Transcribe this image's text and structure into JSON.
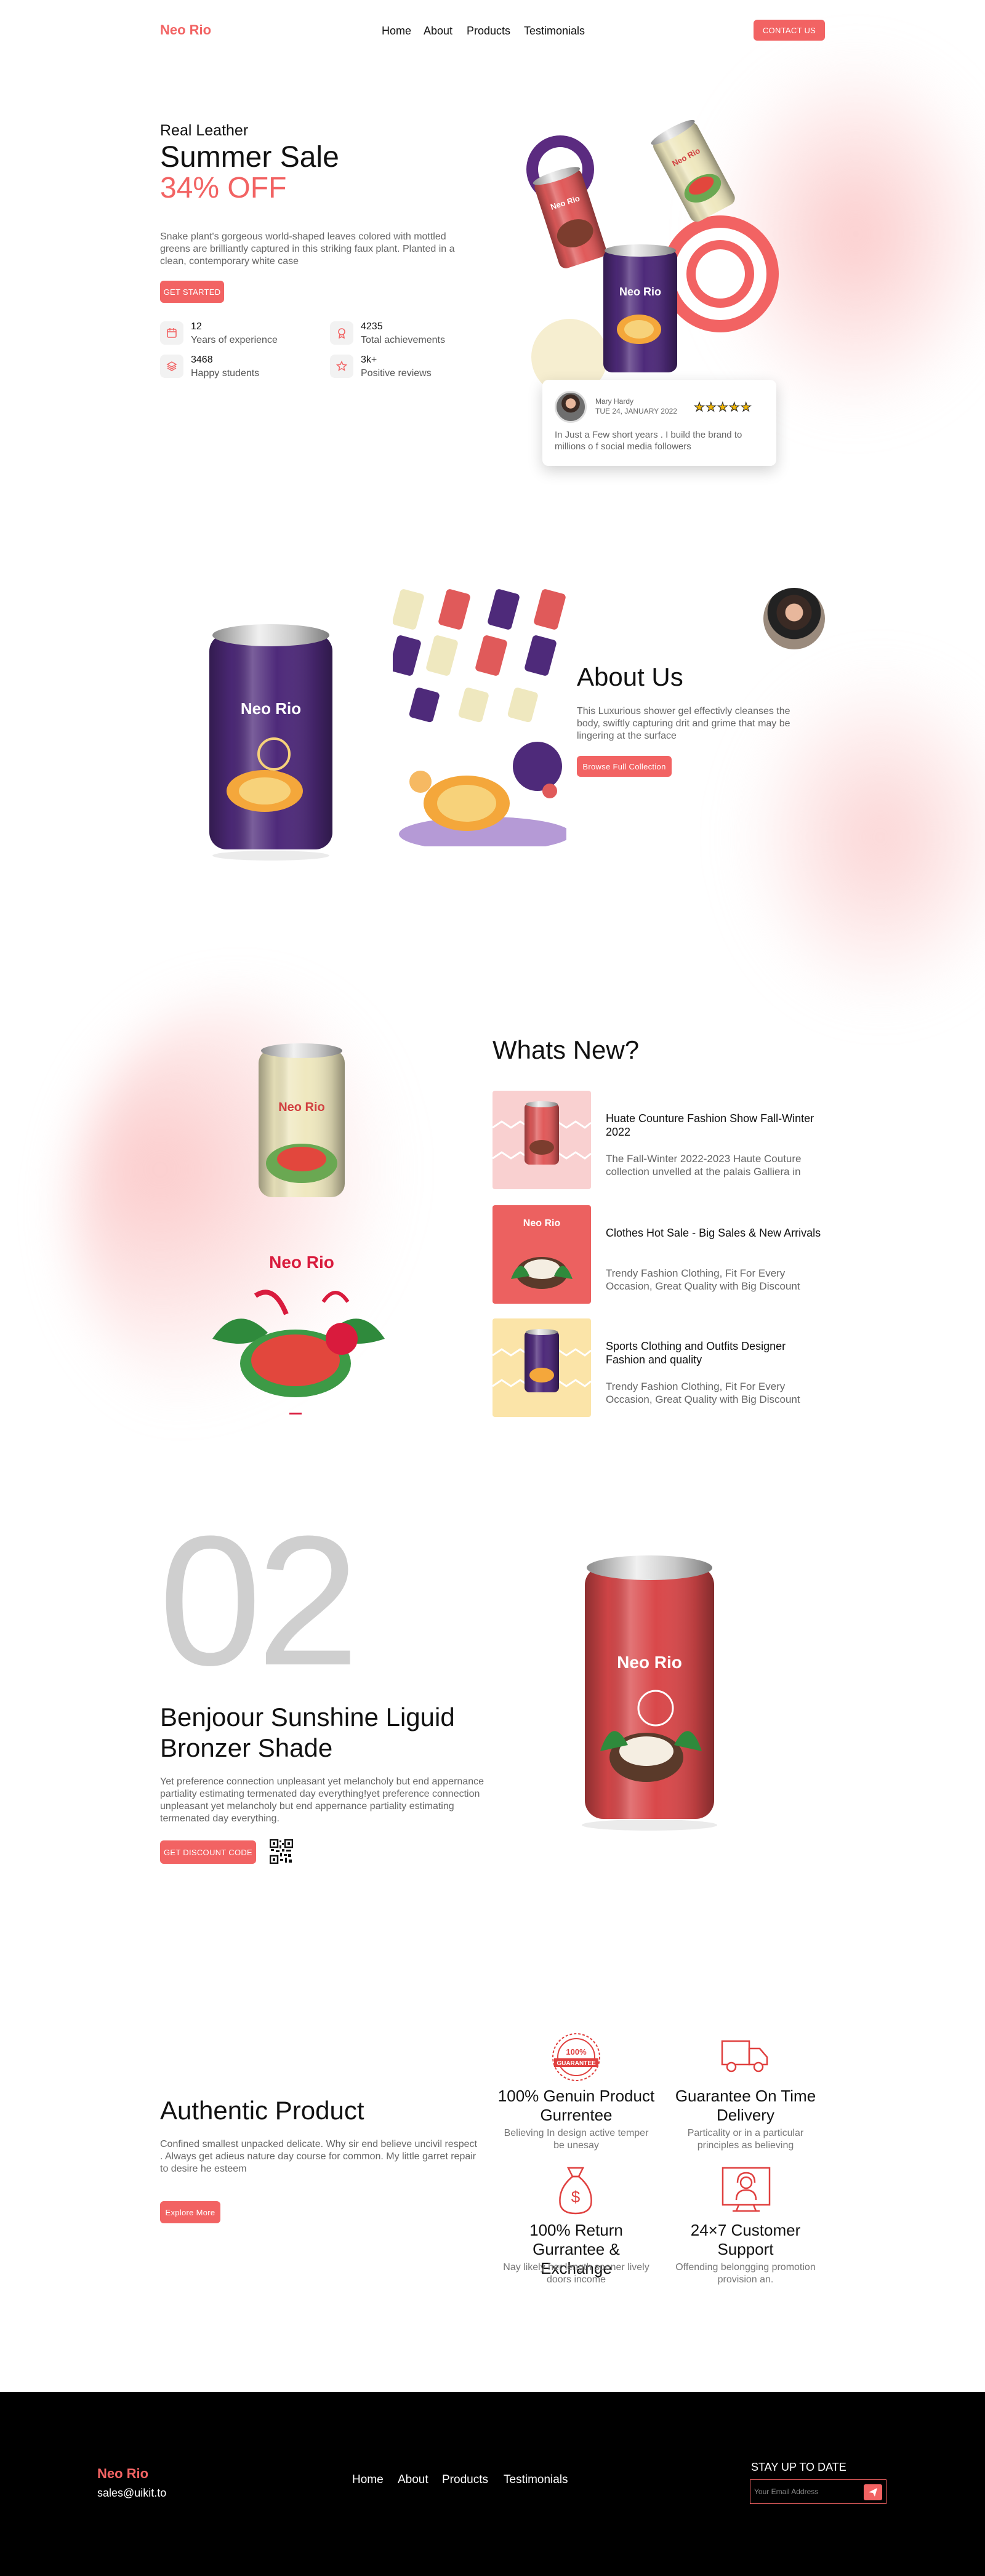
{
  "brand": {
    "name": "Neo Rio",
    "accent": "#f26363"
  },
  "nav": {
    "items": [
      "Home",
      "About",
      "Products",
      "Testimonials"
    ],
    "contact": "CONTACT US"
  },
  "hero": {
    "kicker": "Real Leather",
    "title": "Summer Sale",
    "highlight": "34% OFF",
    "description": "Snake plant's gorgeous world-shaped leaves colored with mottled greens are brilliantly captured in this striking faux plant. Planted in a clean, contemporary white case",
    "cta": "GET STARTED",
    "stats": [
      {
        "value": "12",
        "label": "Years of experience",
        "icon": "calendar-icon"
      },
      {
        "value": "4235",
        "label": "Total achievements",
        "icon": "award-icon"
      },
      {
        "value": "3468",
        "label": "Happy students",
        "icon": "layers-icon"
      },
      {
        "value": "3k+",
        "label": "Positive reviews",
        "icon": "star-icon"
      }
    ],
    "review": {
      "name": "Mary Hardy",
      "date": "TUE 24, JANUARY 2022",
      "rating": 5,
      "text": "In Just a Few short years . I build the brand to millions o f social media followers"
    }
  },
  "can_label": {
    "brand": "Neo Rio"
  },
  "about": {
    "title": "About Us",
    "description": "This Luxurious shower gel effectivly cleanses the body, swiftly capturing drit and grime that may be lingering at the surface",
    "cta": "Browse Full Collection"
  },
  "whats_new": {
    "title": "Whats New?",
    "items": [
      {
        "title": "Huate Counture Fashion Show Fall-Winter 2022",
        "desc": "The Fall-Winter 2022-2023 Haute Couture collection unvelled at the palais Galliera in"
      },
      {
        "title": "Clothes Hot Sale - Big Sales & New Arrivals",
        "desc": "Trendy Fashion Clothing, Fit For Every Occasion, Great Quality with Big Discount"
      },
      {
        "title": "Sports Clothing and Outfits Designer Fashion and quality",
        "desc": "Trendy Fashion Clothing, Fit For Every Occasion, Great Quality with Big Discount"
      }
    ]
  },
  "product": {
    "number": "02",
    "title": "Benjoour Sunshine Liguid Bronzer Shade",
    "description": "Yet preference connection unpleasant yet melancholy but end appernance partiality estimating termenated day everything!yet preference connection unpleasant yet melancholy but end appernance partiality estimating termenated day everything.",
    "cta": "GET DISCOUNT CODE"
  },
  "authentic": {
    "title": "Authentic Product",
    "description": "Confined smallest unpacked delicate. Why sir end believe uncivil respect . Always get adieus nature day course for common. My little garret repair to desire he esteem",
    "cta": "Explore More",
    "features": [
      {
        "title": "100% Genuin Product Gurrentee",
        "desc": "Believing In design active temper be unesay",
        "icon": "guarantee-badge-icon",
        "badge_top": "100%",
        "badge_text": "GUARANTEE"
      },
      {
        "title": "Guarantee On Time Delivery",
        "desc": "Particality or in a particular principles as believing",
        "icon": "truck-icon"
      },
      {
        "title": "100% Return Gurrantee & Exchange",
        "desc": "Nay likely her length sooner lively doors income",
        "icon": "money-bag-icon"
      },
      {
        "title": "24×7 Customer Support",
        "desc": "Offending belongging promotion provision an.",
        "icon": "support-headset-icon"
      }
    ]
  },
  "footer": {
    "brand": "Neo Rio",
    "email": "sales@uikit.to",
    "links": [
      "Home",
      "About",
      "Products",
      "Testimonials"
    ],
    "newsletter_title": "STAY UP TO DATE",
    "email_placeholder": "Your Email Address"
  }
}
